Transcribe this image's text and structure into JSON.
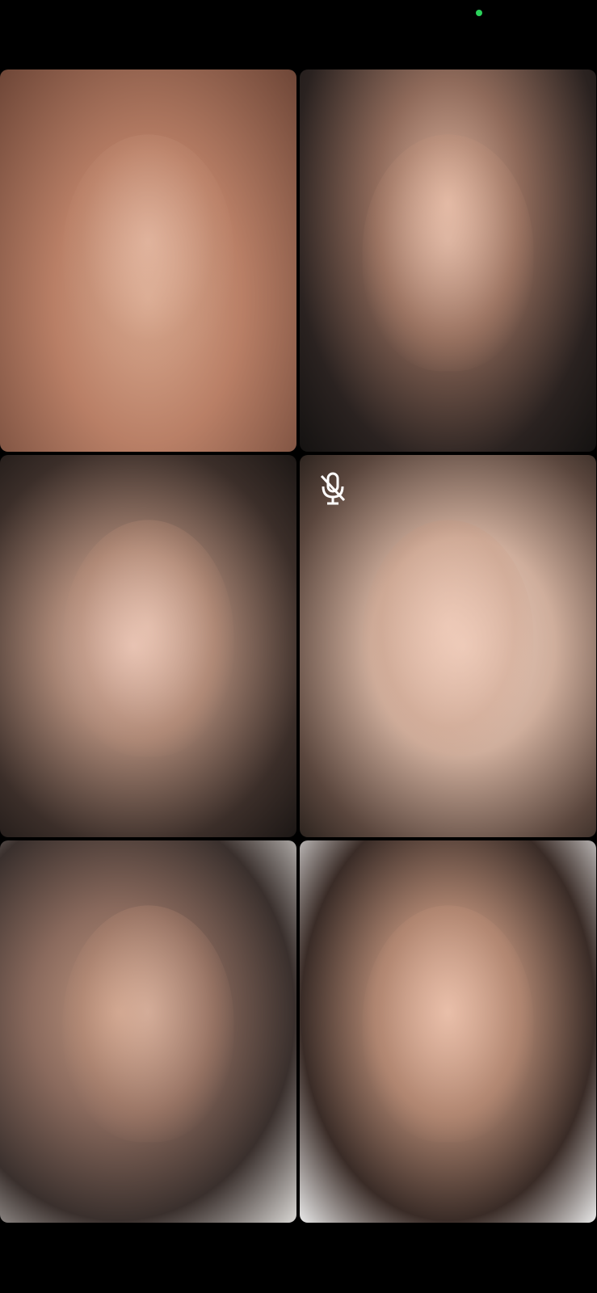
{
  "status_bar": {
    "indicator_color": "#2bd25b"
  },
  "video_grid": {
    "tiles": [
      {
        "position": "top-left",
        "muted": false
      },
      {
        "position": "top-right",
        "muted": false
      },
      {
        "position": "middle-left",
        "muted": false
      },
      {
        "position": "middle-right",
        "muted": true,
        "icon": "mic-off-icon"
      },
      {
        "position": "bottom-left",
        "muted": false
      },
      {
        "position": "bottom-right",
        "muted": false
      }
    ]
  }
}
